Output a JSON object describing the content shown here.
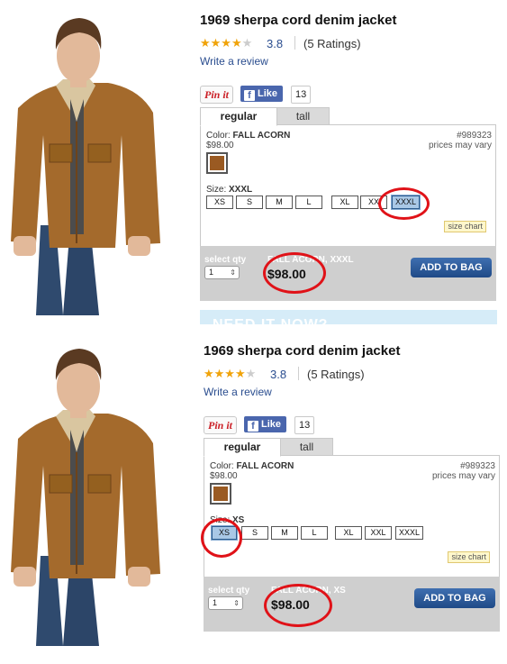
{
  "panels": [
    {
      "product": {
        "title": "1969 sherpa cord denim jacket",
        "stars": "★★★★",
        "star_off": "★",
        "rating": "3.8",
        "rating_count": "(5 Ratings)",
        "write_review": "Write a review"
      },
      "social": {
        "pinit": "Pin it",
        "like": "Like",
        "like_count": "13"
      },
      "tabs": [
        "regular",
        "tall"
      ],
      "options": {
        "color_label": "Color:",
        "color_value": "FALL ACORN",
        "base_price": "$98.00",
        "item_number": "#989323",
        "prices_vary": "prices may vary",
        "size_label": "Size:",
        "size_value": "XXXL",
        "sizes": [
          "XS",
          "S",
          "M",
          "L",
          "XL",
          "XX",
          "XXXL"
        ],
        "selected_size": "XXXL",
        "size_chart": "size chart"
      },
      "buy": {
        "qty_label": "select qty",
        "qty_value": "1",
        "selection": "FALL ACORN, XXXL",
        "price": "$98.00",
        "add_to_bag": "ADD TO BAG"
      },
      "banner_text": "NEED IT NOW?"
    },
    {
      "product": {
        "title": "1969 sherpa cord denim jacket",
        "stars": "★★★★",
        "star_off": "★",
        "rating": "3.8",
        "rating_count": "(5 Ratings)",
        "write_review": "Write a review"
      },
      "social": {
        "pinit": "Pin it",
        "like": "Like",
        "like_count": "13"
      },
      "tabs": [
        "regular",
        "tall"
      ],
      "options": {
        "color_label": "Color:",
        "color_value": "FALL ACORN",
        "base_price": "$98.00",
        "item_number": "#989323",
        "prices_vary": "prices may vary",
        "size_label": "Size:",
        "size_value": "XS",
        "sizes": [
          "XS",
          "S",
          "M",
          "L",
          "XL",
          "XXL",
          "XXXL"
        ],
        "selected_size": "XS",
        "size_chart": "size chart"
      },
      "buy": {
        "qty_label": "select qty",
        "qty_value": "1",
        "selection": "FALL ACORN, XS",
        "price": "$98.00",
        "add_to_bag": "ADD TO BAG"
      }
    }
  ],
  "colors": {
    "accent_blue": "#2a4d8f",
    "star": "#f0a30a",
    "swatch": "#9a5a22",
    "annotation": "#e01218",
    "selected_size": "#a9c8e6"
  }
}
